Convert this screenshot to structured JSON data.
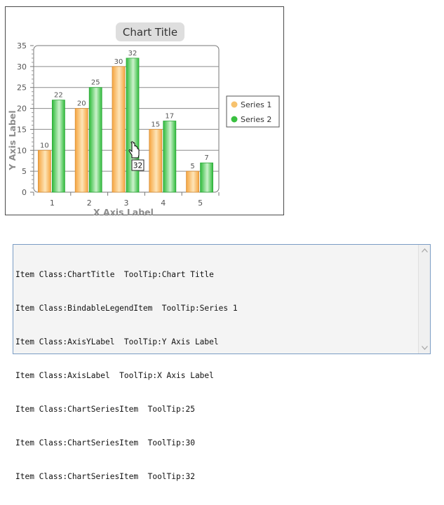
{
  "chart": {
    "title": "Chart Title",
    "tooltip": "32"
  },
  "chart_data": {
    "type": "bar",
    "categories": [
      "1",
      "2",
      "3",
      "4",
      "5"
    ],
    "series": [
      {
        "name": "Series 1",
        "values": [
          10,
          20,
          30,
          15,
          5
        ],
        "color": "#f7a747"
      },
      {
        "name": "Series 2",
        "values": [
          22,
          25,
          32,
          17,
          7
        ],
        "color": "#3dbf48"
      }
    ],
    "title": "Chart Title",
    "xlabel": "X Axis Label",
    "ylabel": "Y Axis Label",
    "ylim": [
      0,
      35
    ],
    "yticks": [
      0,
      5,
      10,
      15,
      20,
      25,
      30,
      35
    ],
    "grid": true,
    "legend": "right"
  },
  "log": {
    "lines": [
      "Item Class:ChartTitle  ToolTip:Chart Title",
      "Item Class:BindableLegendItem  ToolTip:Series 1",
      "Item Class:AxisYLabel  ToolTip:Y Axis Label",
      "Item Class:AxisLabel  ToolTip:X Axis Label",
      "Item Class:ChartSeriesItem  ToolTip:25",
      "Item Class:ChartSeriesItem  ToolTip:30",
      "Item Class:ChartSeriesItem  ToolTip:32"
    ]
  },
  "icons": {
    "cursor": "hand-pointer-icon",
    "scroll_up": "chevron-up-icon",
    "scroll_down": "chevron-down-icon"
  }
}
